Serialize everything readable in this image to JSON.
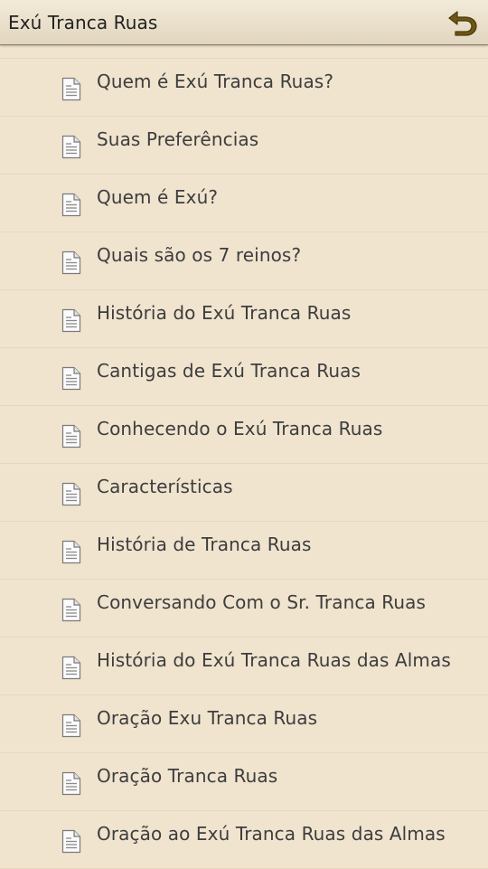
{
  "appbar": {
    "title": "Exú Tranca Ruas",
    "back_icon": "back-arrow-icon",
    "accent_color": "#6e5714"
  },
  "list": {
    "item_icon": "document-icon",
    "items": [
      {
        "label": "Quem é Exú Tranca Ruas?"
      },
      {
        "label": "Suas Preferências"
      },
      {
        "label": "Quem é Exú?"
      },
      {
        "label": "Quais são os 7 reinos?"
      },
      {
        "label": "História do Exú Tranca Ruas"
      },
      {
        "label": "Cantigas de Exú Tranca Ruas"
      },
      {
        "label": "Conhecendo o Exú Tranca Ruas"
      },
      {
        "label": "Características"
      },
      {
        "label": "História de Tranca Ruas"
      },
      {
        "label": "Conversando Com o Sr. Tranca Ruas"
      },
      {
        "label": "História do Exú Tranca Ruas das Almas"
      },
      {
        "label": "Oração Exu Tranca Ruas"
      },
      {
        "label": "Oração Tranca Ruas"
      },
      {
        "label": "Oração ao Exú Tranca Ruas das Almas"
      }
    ]
  },
  "colors": {
    "background": "#f0e4cf",
    "divider": "#e6d8bf",
    "text": "#3d3d3d"
  }
}
